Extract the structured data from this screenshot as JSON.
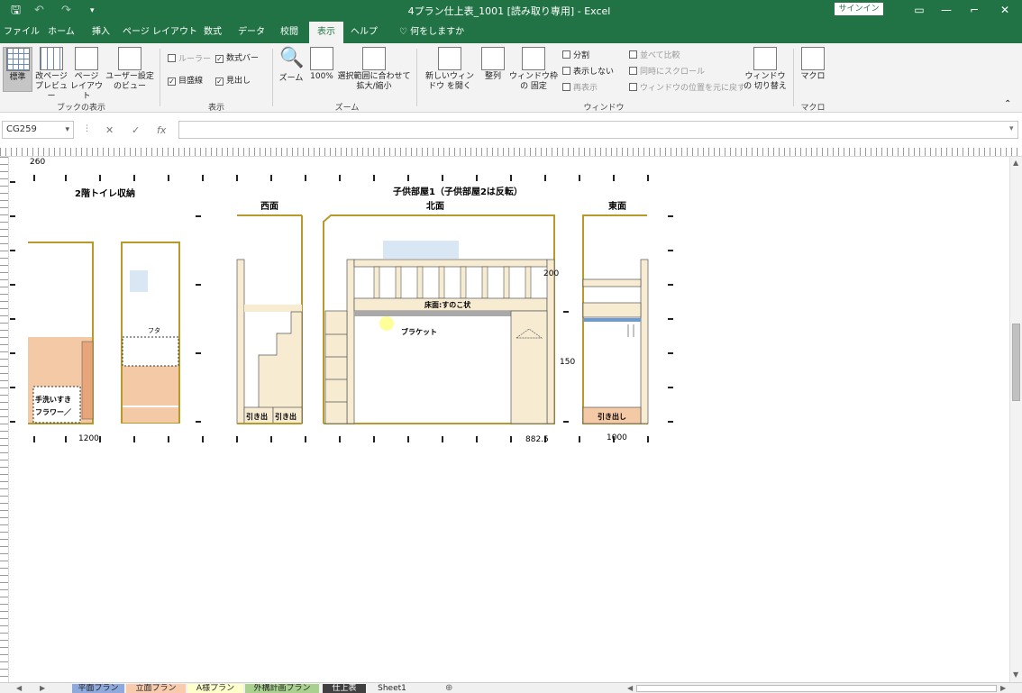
{
  "app": {
    "title": "4プラン仕上表_1001 [読み取り専用] - Excel",
    "signin_label": "サインイン"
  },
  "tabs": [
    "ファイル",
    "ホーム",
    "挿入",
    "ページ レイアウト",
    "数式",
    "データ",
    "校閲",
    "表示",
    "ヘルプ",
    "何をしますか"
  ],
  "ribbon": {
    "workbook_views": {
      "normal": "標準",
      "page_break": "改ページ プレビュー",
      "page_layout": "ページ レイアウト",
      "custom_views": "ユーザー設定 のビュー",
      "group_label": "ブックの表示"
    },
    "show": {
      "ruler": "ルーラー",
      "formula_bar": "数式バー",
      "gridlines": "目盛線",
      "headings": "見出し",
      "group_label": "表示"
    },
    "zoom": {
      "zoom": "ズーム",
      "hundred": "100%",
      "zoom_to_selection": "選択範囲に合わせて 拡大/縮小",
      "group_label": "ズーム"
    },
    "window": {
      "new_window": "新しいウィンドウ を開く",
      "arrange": "整列",
      "freeze": "ウィンドウ枠の 固定",
      "split": "分割",
      "hide": "表示しない",
      "unhide": "再表示",
      "side_by_side": "並べて比較",
      "sync_scroll": "同時にスクロール",
      "reset_pos": "ウィンドウの位置を元に戻す",
      "switch": "ウィンドウの 切り替え",
      "group_label": "ウィンドウ"
    },
    "macro": {
      "macro": "マクロ",
      "group_label": "マクロ"
    }
  },
  "formula_bar": {
    "name_box": "CG259",
    "cancel": "✕",
    "enter": "✓",
    "fx": "fx",
    "content": ""
  },
  "drawing": {
    "dim_260": "260",
    "toilet_title": "2階トイレ収納",
    "child_room_title": "子供部屋1（子供部屋2は反転）",
    "west": "西面",
    "north": "北面",
    "east": "東面",
    "hand_wash": "手洗いすき",
    "hand_wash2": "フラワー／",
    "fta": "フタ",
    "floor_label": "床面:すのこ状",
    "bracket": "ブラケット",
    "dim_200": "200",
    "dim_150": "150",
    "drawer1": "引き出",
    "drawer2": "引き出",
    "drawer_east": "引き出し",
    "dim_1200": "1200",
    "dim_8825": "882.5",
    "dim_1000": "1000"
  },
  "sheet_tabs": [
    "平面プラン",
    "立面プラン",
    "A様プラン",
    "外構計画プラン",
    "仕上表",
    "Sheet1"
  ],
  "colors": {
    "excel_green": "#217346",
    "wall_gold": "#b89a2a",
    "wood": "#f7ecd2",
    "peach": "#f4c9a6",
    "window_blue": "#d9e6f4",
    "bracket_yellow": "#ffff99",
    "bar_gray": "#a9a9a9"
  }
}
